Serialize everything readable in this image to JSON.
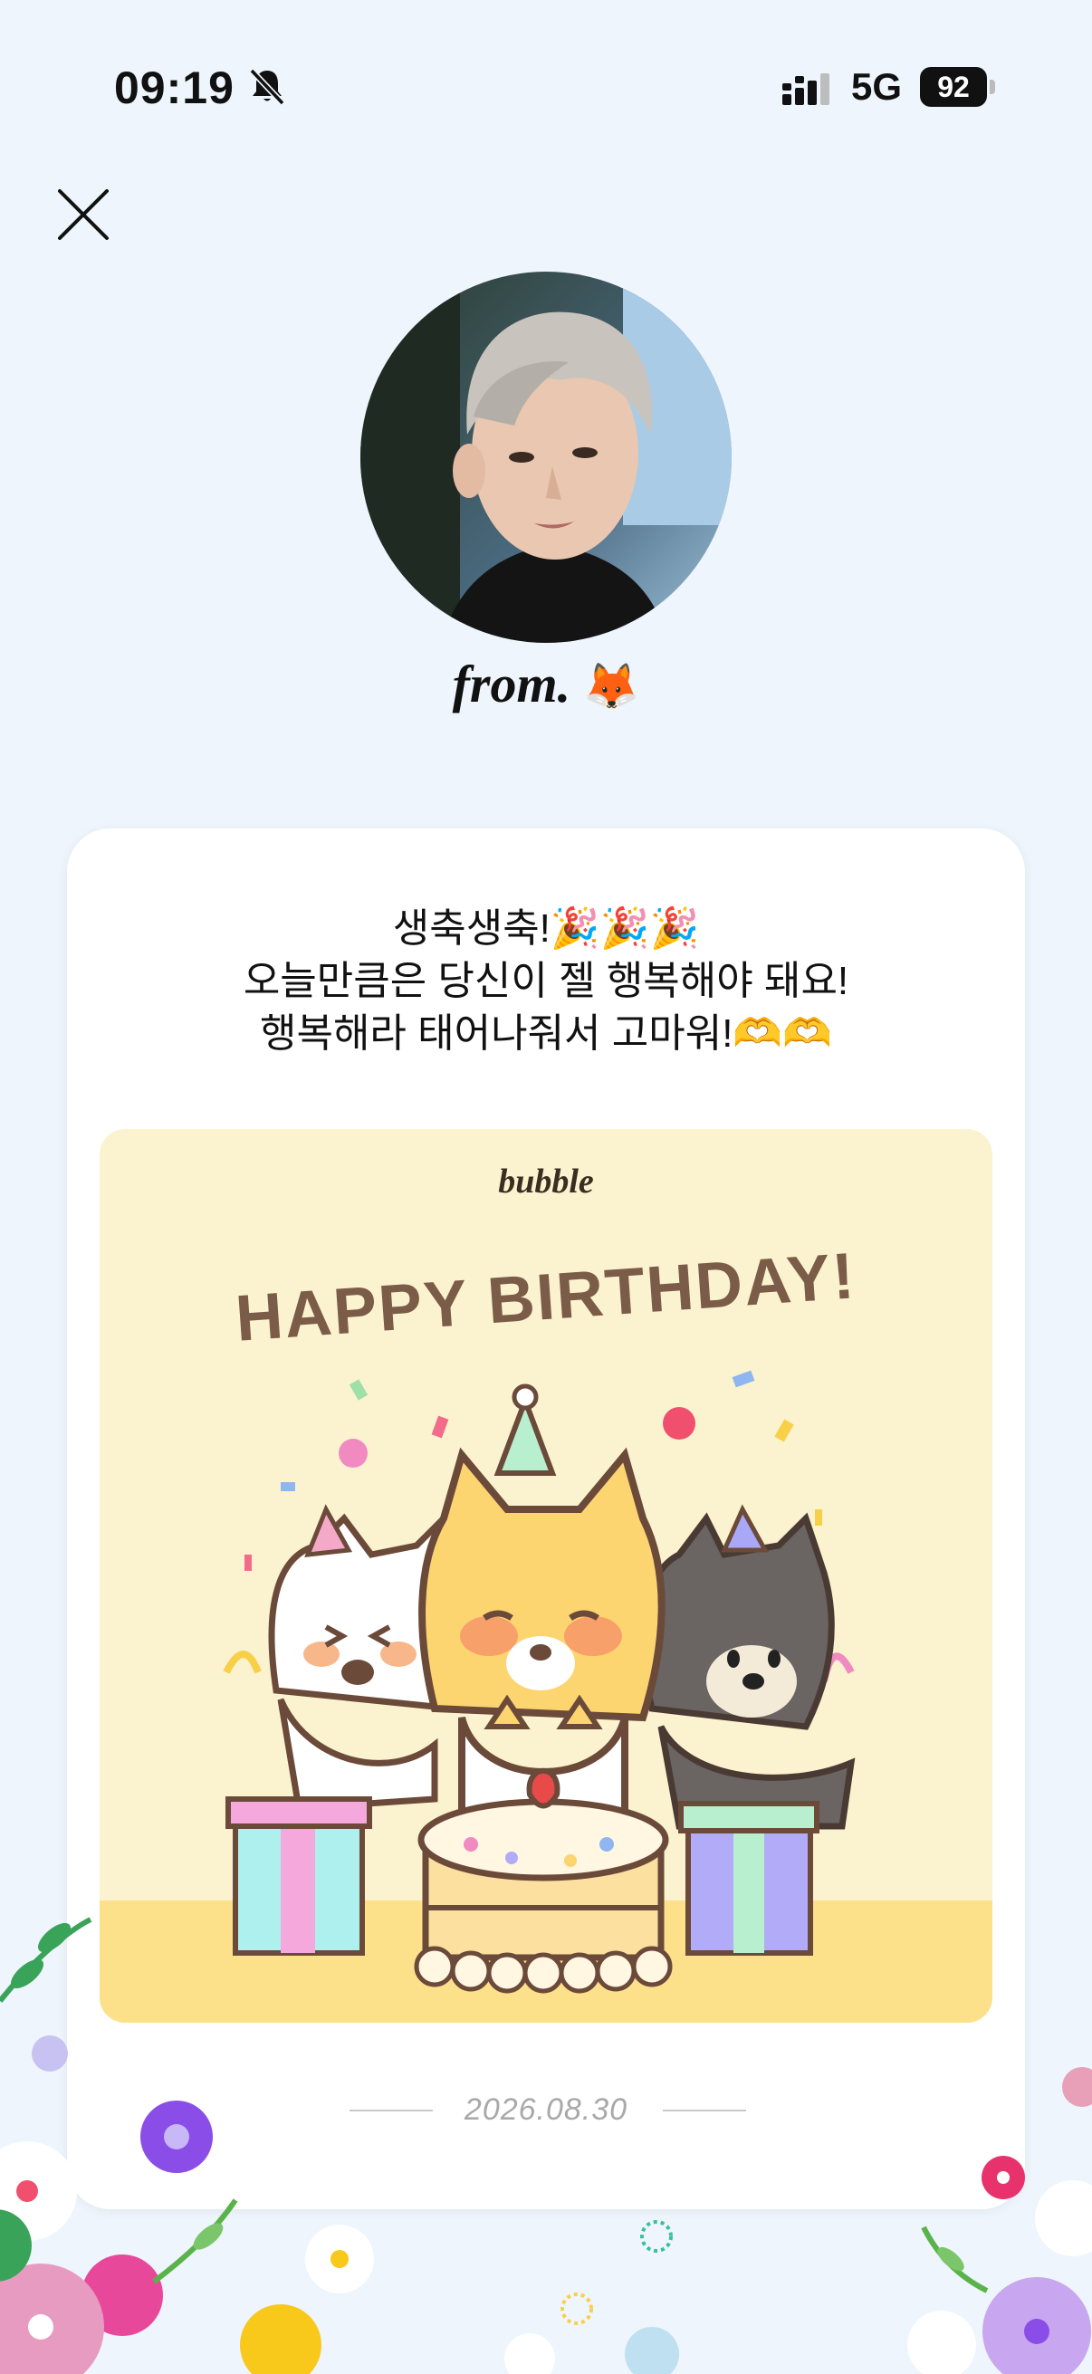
{
  "status": {
    "time": "09:19",
    "network": "5G",
    "battery": "92"
  },
  "header": {
    "from_label": "from.",
    "from_emoji": "🦊"
  },
  "message": {
    "lines": [
      "생축생축!🎉🎉🎉",
      "오늘만큼은 당신이 젤 행복해야 돼요!",
      "행복해라 태어나줘서 고마워!🫶🫶"
    ]
  },
  "card": {
    "brand": "bubble",
    "headline": "HAPPY BIRTHDAY!",
    "date": "2026.08.30"
  },
  "colors": {
    "background": "#eef5fc",
    "card_bg": "#fbf3cf",
    "headline": "#7a5c48"
  },
  "icons": {
    "close": "close-icon",
    "mute": "bell-slash-icon",
    "signal": "signal-icon"
  }
}
